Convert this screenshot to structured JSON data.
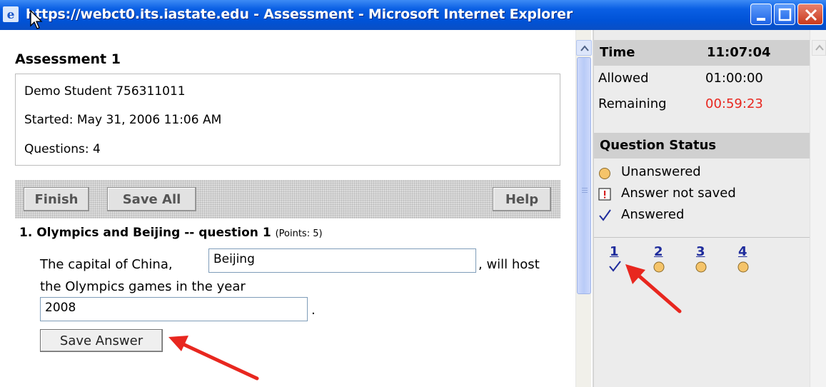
{
  "window": {
    "title": "https://webct0.its.iastate.edu - Assessment - Microsoft Internet Explorer"
  },
  "assessment": {
    "title": "Assessment 1",
    "student": "Demo Student 756311011",
    "started": "Started: May 31, 2006 11:06 AM",
    "questions": "Questions: 4"
  },
  "toolbar": {
    "finish_label": "Finish",
    "save_all_label": "Save All",
    "help_label": "Help"
  },
  "question": {
    "title": "1. Olympics and Beijing",
    "subtitle": " -- question 1",
    "points": "(Points: 5)",
    "text_before": "The capital of China,",
    "answer1": "Beijing",
    "text_after": ", will host",
    "text_line2": "the Olympics games in the year",
    "answer2": "2008",
    "period": ".",
    "save_label": "Save Answer"
  },
  "timer": {
    "time_label": "Time",
    "time_value": "11:07:04",
    "allowed_label": "Allowed",
    "allowed_value": "01:00:00",
    "remaining_label": "Remaining",
    "remaining_value": "00:59:23"
  },
  "status": {
    "heading": "Question Status",
    "legend": [
      {
        "label": "Unanswered"
      },
      {
        "label": "Answer not saved"
      },
      {
        "label": "Answered"
      }
    ],
    "questions": [
      {
        "num": "1",
        "state": "answered"
      },
      {
        "num": "2",
        "state": "unanswered"
      },
      {
        "num": "3",
        "state": "unanswered"
      },
      {
        "num": "4",
        "state": "unanswered"
      }
    ]
  },
  "colors": {
    "remaining": "#e8271f",
    "unanswered_dot": "#f5c46a",
    "link": "#1f2c9c",
    "arrow": "#e8271f"
  }
}
